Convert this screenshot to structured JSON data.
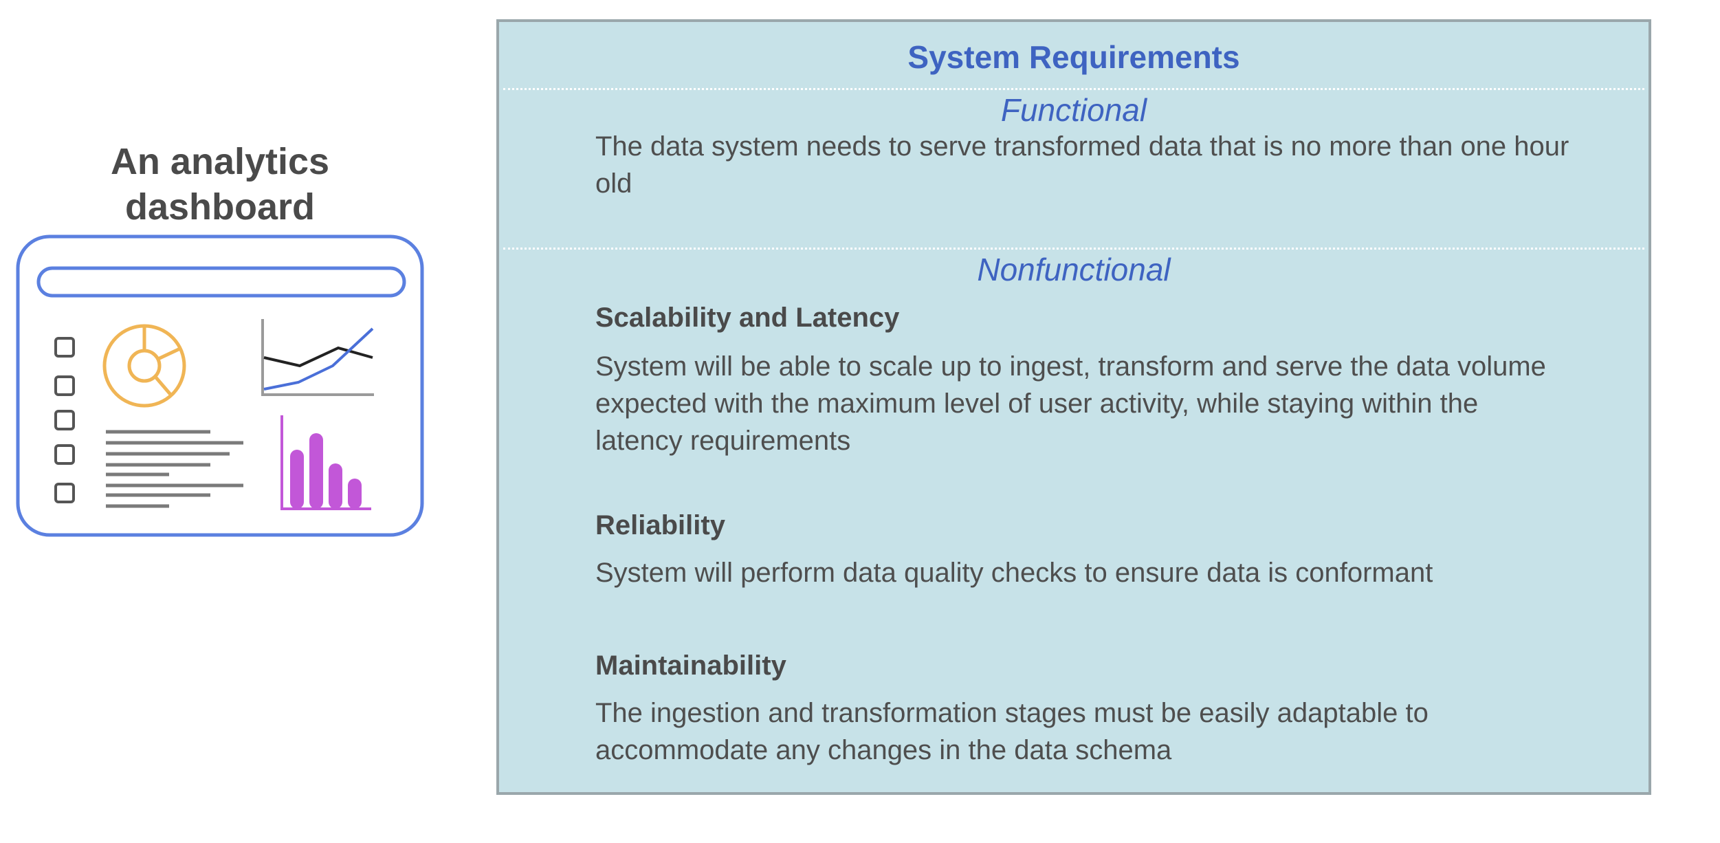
{
  "dashboard": {
    "title_line1": "An analytics",
    "title_line2": "dashboard",
    "colors": {
      "frame": "#5b80e0",
      "donut": "#f0b555",
      "line_dark": "#222222",
      "line_blue": "#4a6fd8",
      "bars": "#c257d8",
      "text_lines": "#7a7a7a"
    },
    "icons": [
      "search-bar",
      "checkbox",
      "donut-chart",
      "line-chart",
      "text-lines",
      "bar-chart"
    ]
  },
  "panel": {
    "title": "System Requirements",
    "background": "#c7e2e8",
    "functional": {
      "heading": "Functional",
      "text": "The data system needs to serve transformed data that is no more than one hour old"
    },
    "nonfunctional": {
      "heading": "Nonfunctional",
      "items": [
        {
          "title": "Scalability and Latency",
          "text": "System will be able to scale up to ingest, transform and serve the data volume expected with the maximum level of user activity, while staying within the latency requirements"
        },
        {
          "title": "Reliability",
          "text": "System will perform data quality checks to ensure data is conformant"
        },
        {
          "title": "Maintainability",
          "text": "The ingestion and transformation stages must be easily adaptable to accommodate any changes in the data schema"
        }
      ]
    }
  }
}
